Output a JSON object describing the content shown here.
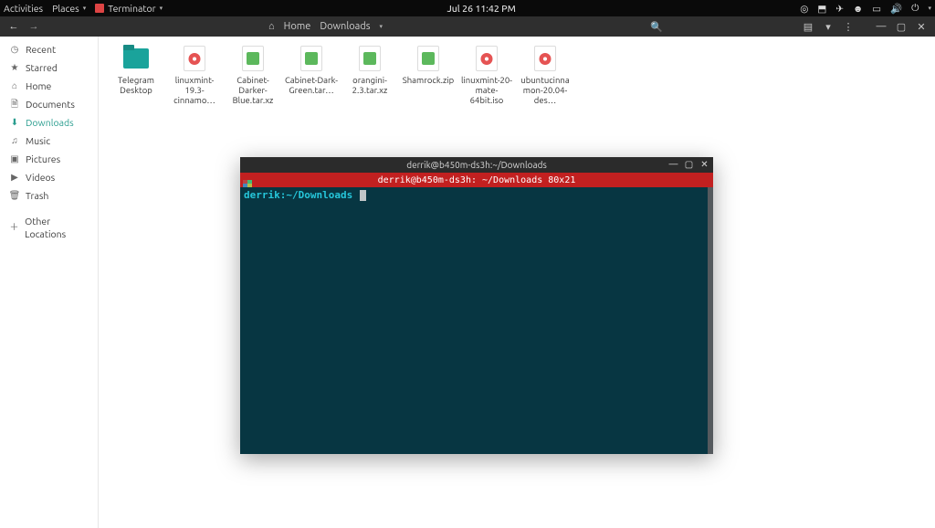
{
  "topbar": {
    "activities": "Activities",
    "places": "Places",
    "app": "Terminator",
    "clock": "Jul 26  11:42 PM"
  },
  "fm": {
    "breadcrumb_home": "Home",
    "breadcrumb_current": "Downloads"
  },
  "sidebar": {
    "items": [
      {
        "label": "Recent",
        "icon": "◷"
      },
      {
        "label": "Starred",
        "icon": "★"
      },
      {
        "label": "Home",
        "icon": "⌂"
      },
      {
        "label": "Documents",
        "icon": "🗎"
      },
      {
        "label": "Downloads",
        "icon": "⬇"
      },
      {
        "label": "Music",
        "icon": "♫"
      },
      {
        "label": "Pictures",
        "icon": "▣"
      },
      {
        "label": "Videos",
        "icon": "▶"
      },
      {
        "label": "Trash",
        "icon": "🗑"
      }
    ],
    "other": "Other Locations"
  },
  "files": [
    {
      "label": "Telegram Desktop",
      "type": "folder"
    },
    {
      "label": "linuxmint-19.3-cinnamo…",
      "type": "iso"
    },
    {
      "label": "Cabinet-Darker-Blue.tar.xz",
      "type": "archive"
    },
    {
      "label": "Cabinet-Dark-Green.tar…",
      "type": "archive"
    },
    {
      "label": "orangini-2.3.tar.xz",
      "type": "archive"
    },
    {
      "label": "Shamrock.zip",
      "type": "archive"
    },
    {
      "label": "linuxmint-20-mate-64bit.iso",
      "type": "iso"
    },
    {
      "label": "ubuntucinnamon-20.04-des…",
      "type": "iso"
    }
  ],
  "terminal": {
    "title": "derrik@b450m-ds3h:~/Downloads",
    "tab": "derrik@b450m-ds3h: ~/Downloads 80x21",
    "prompt_user": "derrik:",
    "prompt_path": "~/Downloads",
    "colors": {
      "tab_bg": "#c22020",
      "bg": "#073642"
    }
  }
}
